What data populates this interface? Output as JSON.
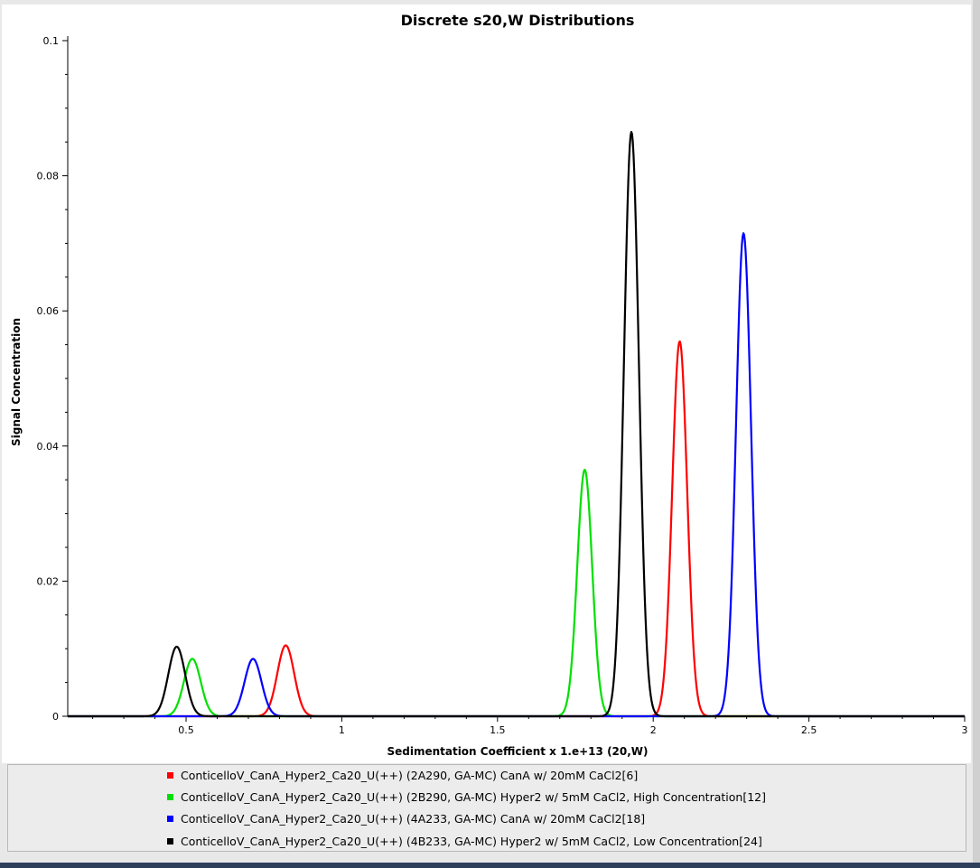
{
  "chart_data": {
    "type": "line",
    "title": "Discrete s20,W Distributions",
    "xlabel": "Sedimentation Coefficient x 1.e+13 (20,W)",
    "ylabel": "Signal Concentration",
    "xlim": [
      0.12,
      3.0
    ],
    "ylim": [
      0,
      0.1
    ],
    "x_ticks": [
      0.5,
      1,
      1.5,
      2,
      2.5,
      3
    ],
    "x_tick_labels": [
      "0.5",
      "1",
      "1.5",
      "2",
      "2.5",
      "3"
    ],
    "y_ticks": [
      0,
      0.02,
      0.04,
      0.06,
      0.08,
      0.1
    ],
    "y_tick_labels": [
      "0",
      "0.02",
      "0.04",
      "0.06",
      "0.08",
      "0.1"
    ],
    "grid": false,
    "legend_position": "bottom",
    "series": [
      {
        "name": "ConticelloV_CanA_Hyper2_Ca20_U(++) (2A290, GA-MC) CanA w/ 20mM CaCl2[6]",
        "color": "#ff0000",
        "peaks": [
          {
            "center": 0.82,
            "height": 0.0105,
            "width": 0.027
          },
          {
            "center": 2.085,
            "height": 0.0555,
            "width": 0.024
          }
        ]
      },
      {
        "name": "ConticelloV_CanA_Hyper2_Ca20_U(++) (2B290, GA-MC) Hyper2 w/ 5mM CaCl2, High Concentration[12]",
        "color": "#00e000",
        "peaks": [
          {
            "center": 0.52,
            "height": 0.0085,
            "width": 0.027
          },
          {
            "center": 1.78,
            "height": 0.0365,
            "width": 0.024
          }
        ]
      },
      {
        "name": "ConticelloV_CanA_Hyper2_Ca20_U(++) (4A233, GA-MC) CanA w/ 20mM CaCl2[18]",
        "color": "#0000ff",
        "peaks": [
          {
            "center": 0.715,
            "height": 0.0085,
            "width": 0.027
          },
          {
            "center": 2.29,
            "height": 0.0715,
            "width": 0.024
          }
        ]
      },
      {
        "name": "ConticelloV_CanA_Hyper2_Ca20_U(++) (4B233, GA-MC) Hyper2 w/ 5mM CaCl2, Low Concentration[24]",
        "color": "#000000",
        "peaks": [
          {
            "center": 0.47,
            "height": 0.0103,
            "width": 0.027
          },
          {
            "center": 1.93,
            "height": 0.0865,
            "width": 0.024
          }
        ]
      }
    ]
  }
}
